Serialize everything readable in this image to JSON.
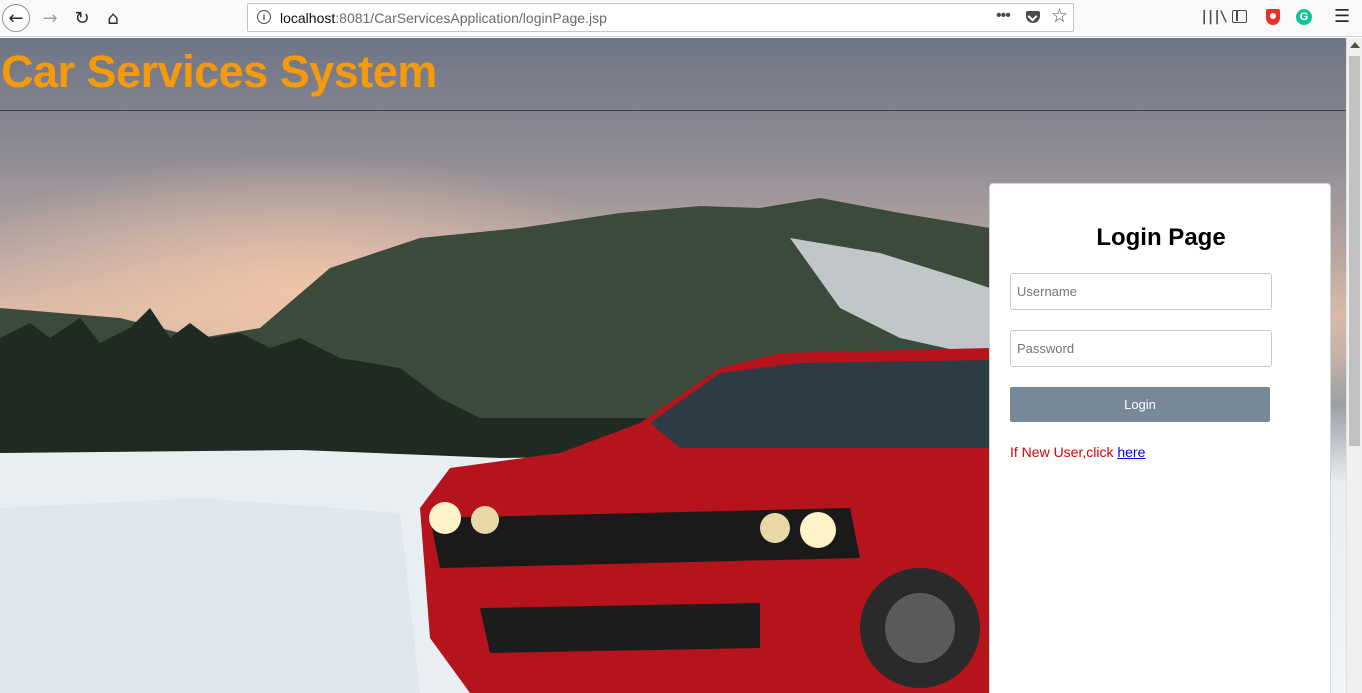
{
  "browser": {
    "url_host": "localhost",
    "url_path": ":8081/CarServicesApplication/loginPage.jsp",
    "page_actions_label": "•••",
    "icons": [
      "back-icon",
      "forward-icon",
      "reload-icon",
      "home-icon",
      "info-icon",
      "page-actions-icon",
      "pocket-icon",
      "bookmark-star-icon",
      "library-icon",
      "sidebar-icon",
      "shield-extension-icon",
      "grammarly-icon",
      "menu-icon"
    ]
  },
  "header": {
    "title": "Car Services System",
    "title_color": "#f59a0b"
  },
  "login": {
    "heading": "Login Page",
    "username_placeholder": "Username",
    "password_placeholder": "Password",
    "login_label": "Login",
    "button_color": "#778899",
    "register_prefix": "If New User,click ",
    "register_link": "here"
  }
}
